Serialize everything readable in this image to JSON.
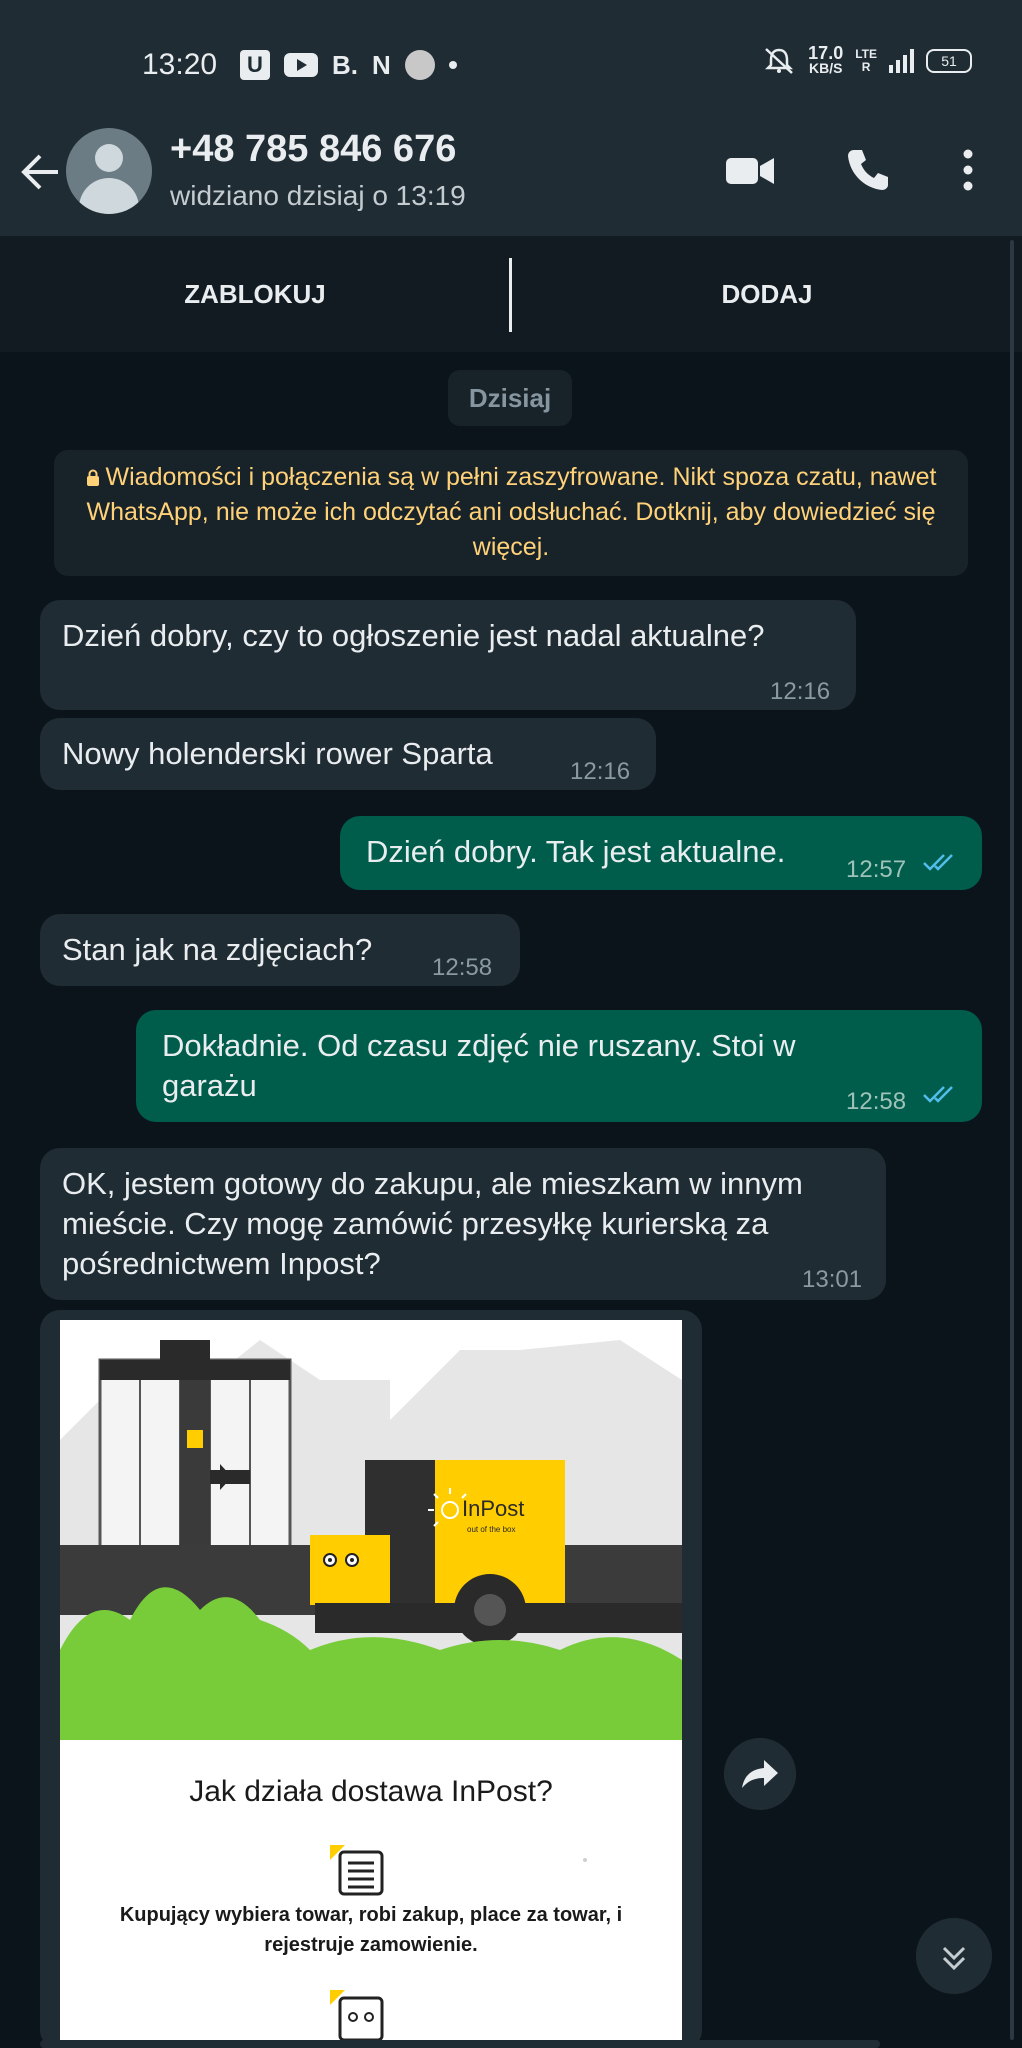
{
  "status_bar": {
    "time": "13:20",
    "icon_u": "U",
    "icon_b": "B.",
    "icon_n": "N",
    "speed_value": "17.0",
    "speed_unit": "KB/S",
    "lte": "LTE",
    "roaming": "R",
    "battery": "51",
    "icons": [
      "u-app-icon",
      "youtube-icon",
      "b-app-icon",
      "n-app-icon",
      "app-circle-icon",
      "dot-icon",
      "mute-icon",
      "signal-icon",
      "battery-icon"
    ]
  },
  "header": {
    "contact_name": "+48 785 846 676",
    "last_seen": "widziano dzisiaj o 13:19",
    "icons": [
      "back-arrow-icon",
      "video-call-icon",
      "phone-icon",
      "more-vert-icon"
    ]
  },
  "actions": {
    "block": "ZABLOKUJ",
    "add": "DODAJ"
  },
  "chat": {
    "date_chip": "Dzisiaj",
    "encryption_notice": "Wiadomości i połączenia są w pełni zaszyfrowane. Nikt spoza czatu, nawet WhatsApp, nie może ich odczytać ani odsłuchać. Dotknij, aby dowiedzieć się więcej.",
    "messages": [
      {
        "direction": "in",
        "text": "Dzień dobry, czy to ogłoszenie jest nadal aktualne?",
        "time": "12:16"
      },
      {
        "direction": "in",
        "text": "Nowy holenderski rower Sparta",
        "time": "12:16"
      },
      {
        "direction": "out",
        "text": "Dzień dobry. Tak jest aktualne.",
        "time": "12:57",
        "status": "read"
      },
      {
        "direction": "in",
        "text": "Stan jak na zdjęciach?",
        "time": "12:58"
      },
      {
        "direction": "out",
        "text": "Dokładnie. Od czasu zdjęć nie ruszany. Stoi w garażu",
        "time": "12:58",
        "status": "read"
      },
      {
        "direction": "in",
        "text": "OK, jestem gotowy do zakupu, ale mieszkam w innym mieście. Czy mogę zamówić przesyłkę kurierską za pośrednictwem Inpost?",
        "time": "13:01"
      }
    ],
    "image_message": {
      "logo_text": "InPost",
      "logo_tagline": "out of the box",
      "title": "Jak działa dostawa InPost?",
      "description": "Kupujący wybiera towar, robi zakup, place za towar, i rejestruje zamowienie."
    }
  },
  "colors": {
    "background": "#0b141a",
    "bar": "#1f2c34",
    "incoming_bubble": "#202c33",
    "outgoing_bubble": "#005c4b",
    "notice_text": "#ffd279",
    "read_ticks": "#53bdeb",
    "inpost_yellow": "#ffcd00"
  }
}
